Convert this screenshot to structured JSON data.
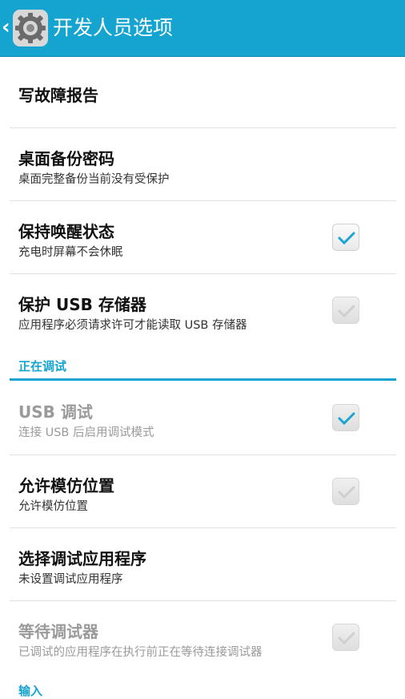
{
  "app_bar": {
    "title": "开发人员选项",
    "back_icon": "back-arrow-icon",
    "app_icon": "settings-gear-icon",
    "background_color": "#14a4cf"
  },
  "items": [
    {
      "title": "写故障报告"
    },
    {
      "title": "桌面备份密码",
      "subtitle": "桌面完整备份当前没有受保护"
    },
    {
      "title": "保持唤醒状态",
      "subtitle": "充电时屏幕不会休眠",
      "checked": true
    },
    {
      "title": "保护 USB 存储器",
      "subtitle": "应用程序必须请求许可才能读取 USB 存储器",
      "checked": false
    }
  ],
  "section_debugging": {
    "header": "正在调试",
    "items": [
      {
        "title": "USB 调试",
        "subtitle": "连接 USB 后启用调试模式",
        "checked": true,
        "enabled": false
      },
      {
        "title": "允许模仿位置",
        "subtitle": "允许模仿位置",
        "checked": false
      },
      {
        "title": "选择调试应用程序",
        "subtitle": "未设置调试应用程序"
      },
      {
        "title": "等待调试器",
        "subtitle": "已调试的应用程序在执行前正在等待连接调试器",
        "checked": false,
        "enabled": false
      }
    ]
  },
  "section_input": {
    "header": "输入"
  },
  "accent_color": "#14a4cf"
}
